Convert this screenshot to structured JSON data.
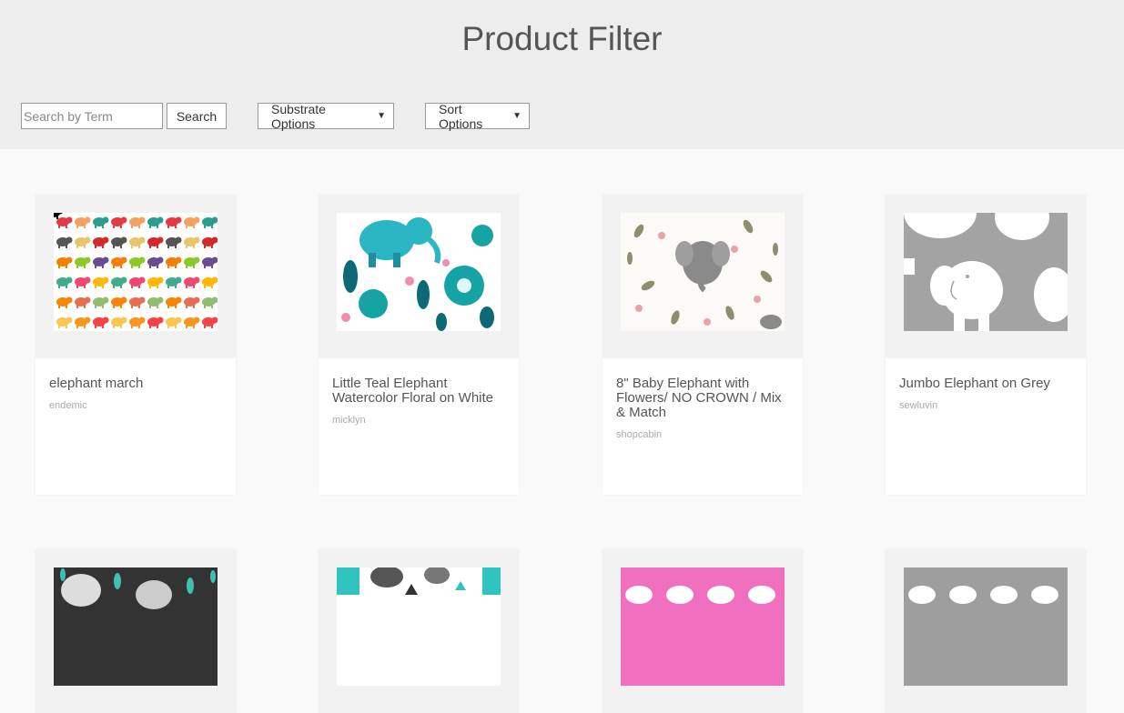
{
  "header": {
    "title": "Product Filter",
    "search_placeholder": "Search by Term",
    "search_button": "Search",
    "substrate_label": "Substrate Options",
    "sort_label": "Sort Options"
  },
  "products": [
    {
      "name": "elephant march",
      "designer": "endemic"
    },
    {
      "name": "Little Teal Elephant Watercolor Floral on White",
      "designer": "micklyn"
    },
    {
      "name": "8\" Baby Elephant with Flowers/ NO CROWN / Mix & Match",
      "designer": "shopcabin"
    },
    {
      "name": "Jumbo Elephant on Grey",
      "designer": "sewluvin"
    }
  ],
  "colors": {
    "header_bg": "#ededed",
    "page_bg": "#f9f9f9",
    "card_bg": "#ffffff",
    "thumb_bg": "#f2f2f2"
  }
}
